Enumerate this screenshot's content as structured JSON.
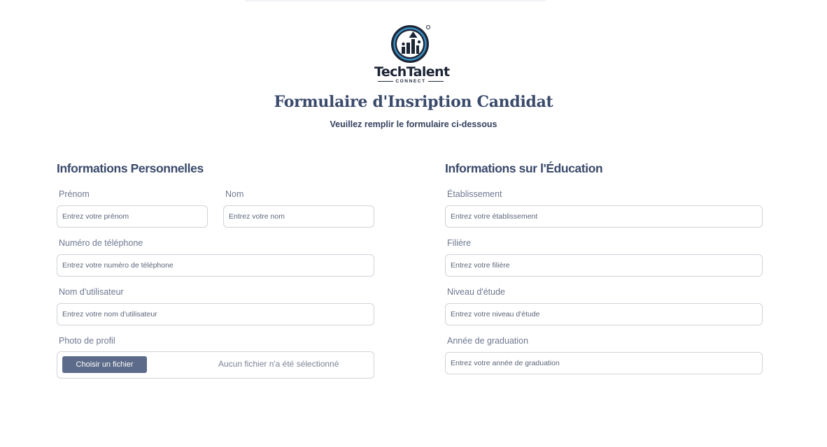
{
  "brand": {
    "name": "TechTalent",
    "tagline": "CONNECT",
    "colors": {
      "navy": "#1c2535",
      "accent": "#3a8fc4"
    }
  },
  "header": {
    "title": "Formulaire d'Insription Candidat",
    "subtitle": "Veuillez remplir le formulaire ci-dessous"
  },
  "personal": {
    "title": "Informations Personnelles",
    "fields": {
      "prenom": {
        "label": "Prénom",
        "placeholder": "Entrez votre prénom",
        "value": ""
      },
      "nom": {
        "label": "Nom",
        "placeholder": "Entrez votre nom",
        "value": ""
      },
      "telephone": {
        "label": "Numéro de téléphone",
        "placeholder": "Entrez votre numéro de téléphone",
        "value": ""
      },
      "username": {
        "label": "Nom d'utilisateur",
        "placeholder": "Entrez votre nom d'utilisateur",
        "value": ""
      },
      "photo": {
        "label": "Photo de profil",
        "button": "Choisir un fichier",
        "status": "Aucun fichier n'a été sélectionné"
      }
    }
  },
  "education": {
    "title": "Informations sur l'Éducation",
    "fields": {
      "etablissement": {
        "label": "Établissement",
        "placeholder": "Entrez votre établissement",
        "value": ""
      },
      "filiere": {
        "label": "Filière",
        "placeholder": "Entrez votre filière",
        "value": ""
      },
      "niveau": {
        "label": "Niveau d'étude",
        "placeholder": "Entrez votre niveau d'étude",
        "value": ""
      },
      "graduation": {
        "label": "Année de graduation",
        "placeholder": "Entrez votre année de graduation",
        "value": ""
      }
    }
  },
  "theme": {
    "heading_color": "#3a4a6b",
    "label_color": "#6f7890",
    "button_color": "#5d6b8a",
    "border_color": "#cfd3da"
  }
}
